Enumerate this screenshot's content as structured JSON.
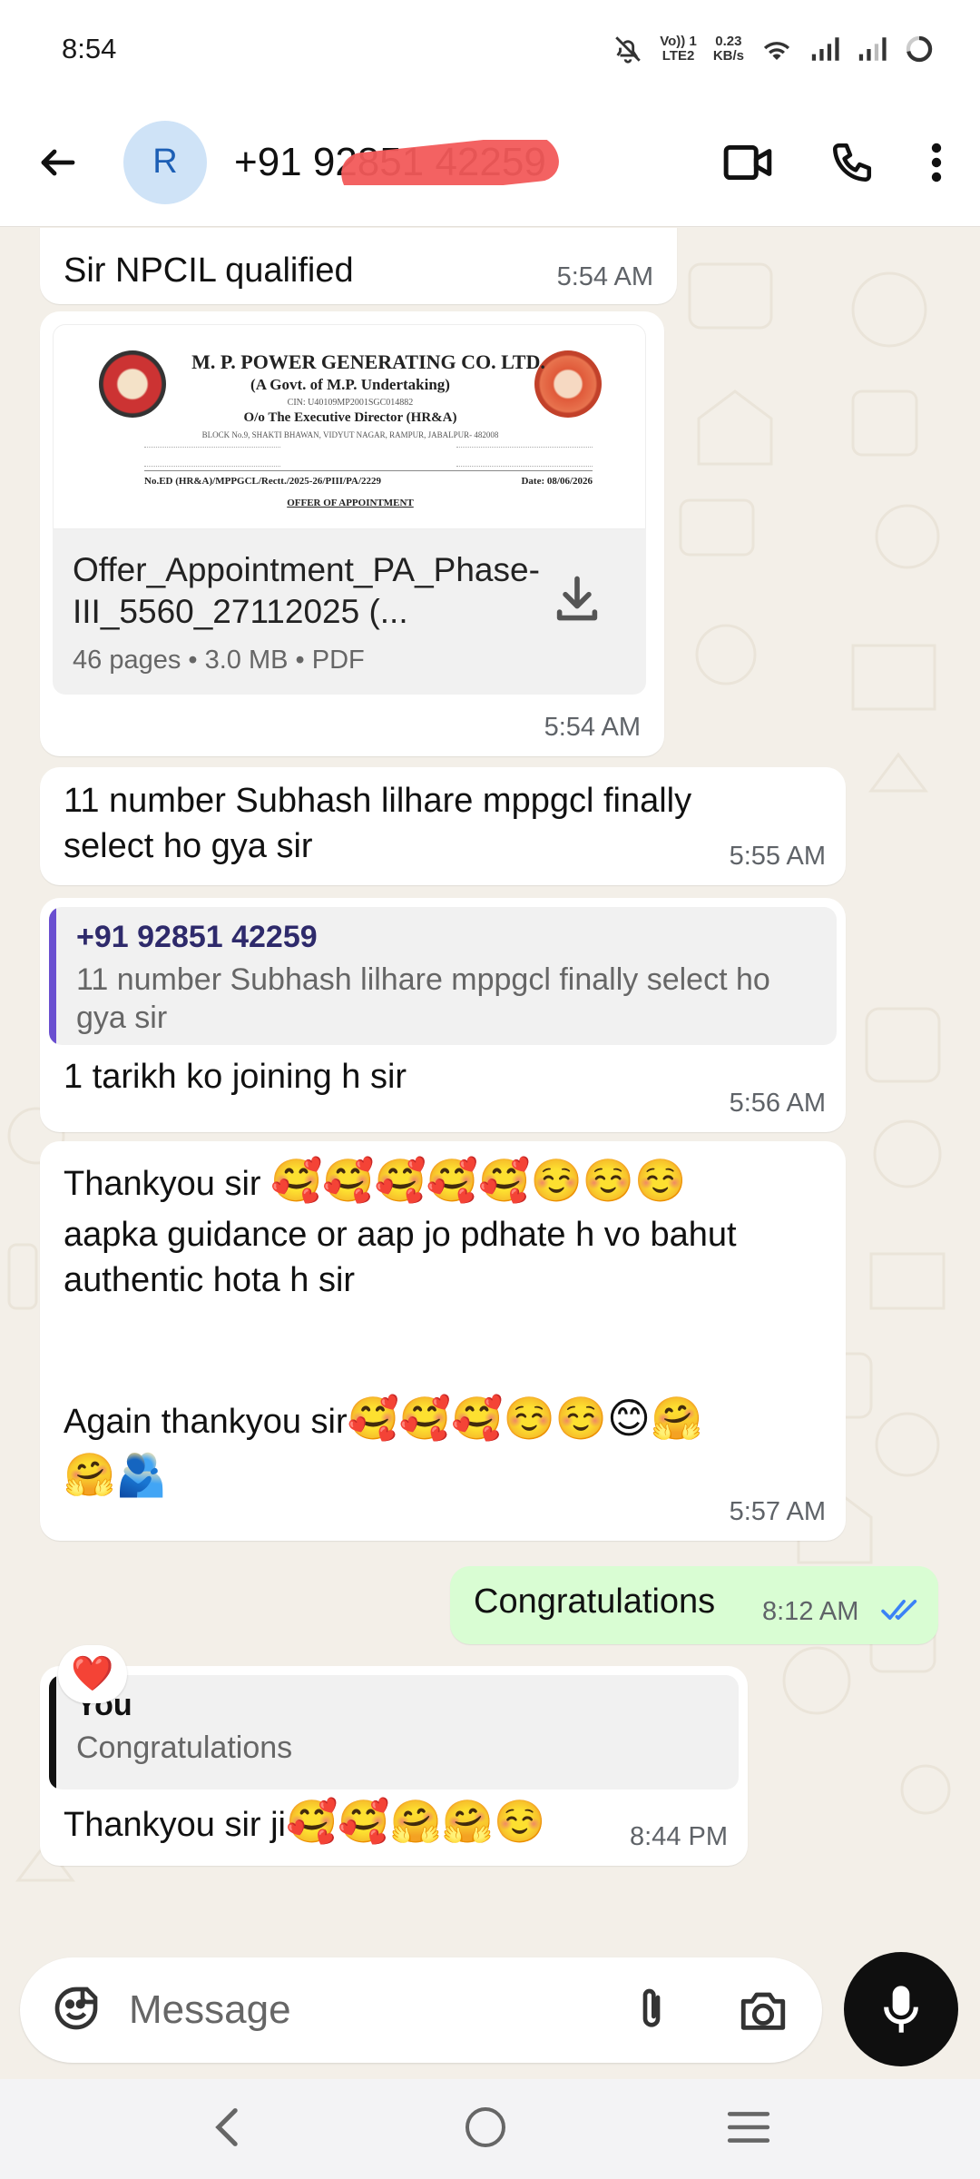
{
  "status_bar": {
    "time": "8:54",
    "network_line1": "Vo)) 1",
    "network_line2": "LTE2",
    "speed_value": "0.23",
    "speed_unit": "KB/s"
  },
  "header": {
    "avatar_letter": "R",
    "contact": "+91 92851 42259"
  },
  "messages": {
    "m1": {
      "text": "Sir NPCIL qualified",
      "time": "5:54 AM"
    },
    "doc": {
      "header_org": "M. P. POWER GENERATING CO. LTD.",
      "header_sub": "(A Govt. of M.P. Undertaking)",
      "header_cin": "CIN: U40109MP2001SGC014882",
      "header_office": "O/o The Executive Director (HR&A)",
      "header_address": "BLOCK No.9, SHAKTI BHAWAN, VIDYUT NAGAR, RAMPUR, JABALPUR- 482008",
      "ref_no": "No.ED (HR&A)/MPPGCL/Rectt./2025-26/PIII/PA/2229",
      "ref_date": "Date: 08/06/2026",
      "letter_title": "OFFER OF APPOINTMENT",
      "file_name": "Offer_Appointment_PA_Phase-III_5560_27112025 (...",
      "meta": "46 pages • 3.0 MB • PDF",
      "time": "5:54 AM"
    },
    "m3": {
      "text": "11 number Subhash lilhare mppgcl finally select ho gya sir",
      "time": "5:55 AM"
    },
    "m4": {
      "quote_name": "+91 92851 42259",
      "quote_text": "11 number Subhash lilhare mppgcl finally select ho gya sir",
      "text": "1 tarikh ko joining h sir",
      "time": "5:56 AM"
    },
    "m5": {
      "line1": "Thankyou sir",
      "line1_emoji": "🥰🥰🥰🥰🥰☺️☺️☺️",
      "line2": "aapka guidance or aap jo pdhate h vo bahut authentic hota h sir",
      "line3": "Again thankyou sir",
      "line3_emoji": "🥰🥰🥰☺️☺️😊🤗",
      "line4_emoji": "🤗🫂",
      "time": "5:57 AM"
    },
    "m6": {
      "text": "Congratulations",
      "time": "8:12 AM"
    },
    "m7": {
      "quote_name": "You",
      "quote_text": "Congratulations",
      "text": "Thankyou sir ji",
      "text_emoji": "🥰🥰🤗🤗☺️",
      "time": "8:44 PM"
    },
    "reaction": "❤️"
  },
  "composer": {
    "placeholder": "Message"
  },
  "colors": {
    "outgoing_bubble": "#d9fdd3",
    "incoming_bubble": "#ffffff",
    "chat_background": "#f3efe8",
    "quote_bar_contact": "#6a4fd0",
    "quote_bar_you": "#111111",
    "read_ticks": "#3b82f6"
  }
}
